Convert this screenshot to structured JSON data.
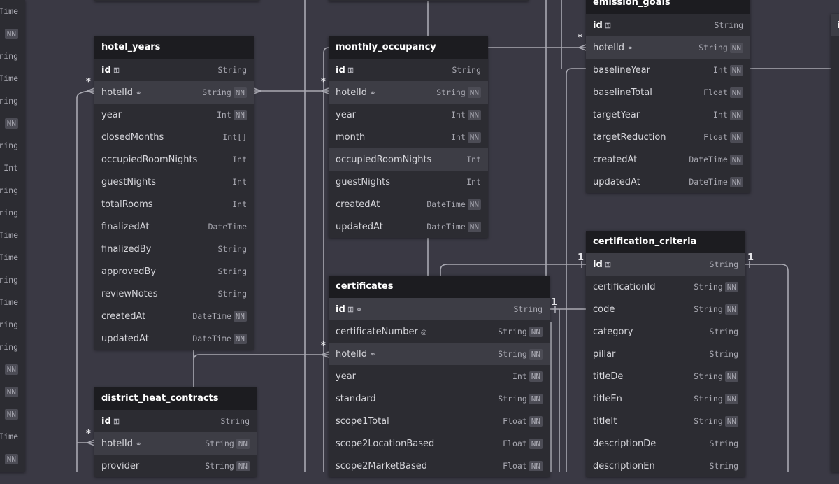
{
  "tables": [
    {
      "name": "hotel_years",
      "rows": [
        {
          "name": "id",
          "pk": true,
          "icons": "key",
          "type": "String",
          "nn": false
        },
        {
          "name": "hotelId",
          "icons": "link",
          "type": "String",
          "nn": true,
          "hl": true
        },
        {
          "name": "year",
          "type": "Int",
          "nn": true
        },
        {
          "name": "closedMonths",
          "type": "Int[]",
          "nn": false
        },
        {
          "name": "occupiedRoomNights",
          "type": "Int",
          "nn": false
        },
        {
          "name": "guestNights",
          "type": "Int",
          "nn": false
        },
        {
          "name": "totalRooms",
          "type": "Int",
          "nn": false
        },
        {
          "name": "finalizedAt",
          "type": "DateTime",
          "nn": false
        },
        {
          "name": "finalizedBy",
          "type": "String",
          "nn": false
        },
        {
          "name": "approvedBy",
          "type": "String",
          "nn": false
        },
        {
          "name": "reviewNotes",
          "type": "String",
          "nn": false
        },
        {
          "name": "createdAt",
          "type": "DateTime",
          "nn": true
        },
        {
          "name": "updatedAt",
          "type": "DateTime",
          "nn": true
        }
      ]
    },
    {
      "name": "monthly_occupancy",
      "rows": [
        {
          "name": "id",
          "pk": true,
          "icons": "key",
          "type": "String",
          "nn": false
        },
        {
          "name": "hotelId",
          "icons": "link",
          "type": "String",
          "nn": true,
          "hl": true
        },
        {
          "name": "year",
          "type": "Int",
          "nn": true
        },
        {
          "name": "month",
          "type": "Int",
          "nn": true
        },
        {
          "name": "occupiedRoomNights",
          "type": "Int",
          "nn": false,
          "hl": true
        },
        {
          "name": "guestNights",
          "type": "Int",
          "nn": false
        },
        {
          "name": "createdAt",
          "type": "DateTime",
          "nn": true
        },
        {
          "name": "updatedAt",
          "type": "DateTime",
          "nn": true
        }
      ]
    },
    {
      "name": "emission_goals",
      "rows": [
        {
          "name": "id",
          "pk": true,
          "icons": "key",
          "type": "String",
          "nn": false
        },
        {
          "name": "hotelId",
          "icons": "link",
          "type": "String",
          "nn": true,
          "hl": true
        },
        {
          "name": "baselineYear",
          "type": "Int",
          "nn": true
        },
        {
          "name": "baselineTotal",
          "type": "Float",
          "nn": true
        },
        {
          "name": "targetYear",
          "type": "Int",
          "nn": true
        },
        {
          "name": "targetReduction",
          "type": "Float",
          "nn": true
        },
        {
          "name": "createdAt",
          "type": "DateTime",
          "nn": true
        },
        {
          "name": "updatedAt",
          "type": "DateTime",
          "nn": true
        }
      ]
    },
    {
      "name": "certification_criteria",
      "rows": [
        {
          "name": "id",
          "pk": true,
          "icons": "key",
          "type": "String",
          "nn": false,
          "hl": true
        },
        {
          "name": "certificationId",
          "type": "String",
          "nn": true
        },
        {
          "name": "code",
          "type": "String",
          "nn": true
        },
        {
          "name": "category",
          "type": "String",
          "nn": false
        },
        {
          "name": "pillar",
          "type": "String",
          "nn": false
        },
        {
          "name": "titleDe",
          "type": "String",
          "nn": true
        },
        {
          "name": "titleEn",
          "type": "String",
          "nn": true
        },
        {
          "name": "titleIt",
          "type": "String",
          "nn": true
        },
        {
          "name": "descriptionDe",
          "type": "String",
          "nn": false
        },
        {
          "name": "descriptionEn",
          "type": "String",
          "nn": false
        }
      ]
    },
    {
      "name": "certificates",
      "rows": [
        {
          "name": "id",
          "pk": true,
          "icons": "key,link",
          "type": "String",
          "nn": false,
          "hl": true
        },
        {
          "name": "certificateNumber",
          "icons": "fingerprint",
          "type": "String",
          "nn": true
        },
        {
          "name": "hotelId",
          "icons": "link",
          "type": "String",
          "nn": true,
          "hl": true
        },
        {
          "name": "year",
          "type": "Int",
          "nn": true
        },
        {
          "name": "standard",
          "type": "String",
          "nn": true
        },
        {
          "name": "scope1Total",
          "type": "Float",
          "nn": true
        },
        {
          "name": "scope2LocationBased",
          "type": "Float",
          "nn": true
        },
        {
          "name": "scope2MarketBased",
          "type": "Float",
          "nn": true
        }
      ]
    },
    {
      "name": "district_heat_contracts",
      "rows": [
        {
          "name": "id",
          "pk": true,
          "icons": "key",
          "type": "String",
          "nn": false
        },
        {
          "name": "hotelId",
          "icons": "link",
          "type": "String",
          "nn": true,
          "hl": true
        },
        {
          "name": "provider",
          "type": "String",
          "nn": true
        }
      ]
    }
  ],
  "left_edge": [
    {
      "type": "Time"
    },
    {
      "nn": "NN"
    },
    {
      "type": "ring"
    },
    {
      "type": "Time"
    },
    {
      "type": "ring"
    },
    {
      "nn": "NN"
    },
    {
      "type": "ring"
    },
    {
      "type": "Int"
    },
    {
      "type": "ring"
    },
    {
      "type": "ring"
    },
    {
      "type": "Time"
    },
    {
      "type": "Time"
    },
    {
      "type": "ring"
    },
    {
      "type": "Time"
    },
    {
      "type": "ring"
    },
    {
      "type": "ring"
    },
    {
      "nn": "NN"
    },
    {
      "nn": "NN"
    },
    {
      "nn": "NN"
    },
    {
      "type": "Time"
    },
    {
      "nn": "NN"
    }
  ],
  "right_edge": [
    "i",
    "",
    "",
    "",
    "",
    "",
    "",
    "",
    "",
    "",
    "",
    "",
    "",
    "",
    "",
    "",
    "",
    "",
    "",
    "",
    ""
  ],
  "cardinality": {
    "many": "*",
    "one": "1"
  }
}
